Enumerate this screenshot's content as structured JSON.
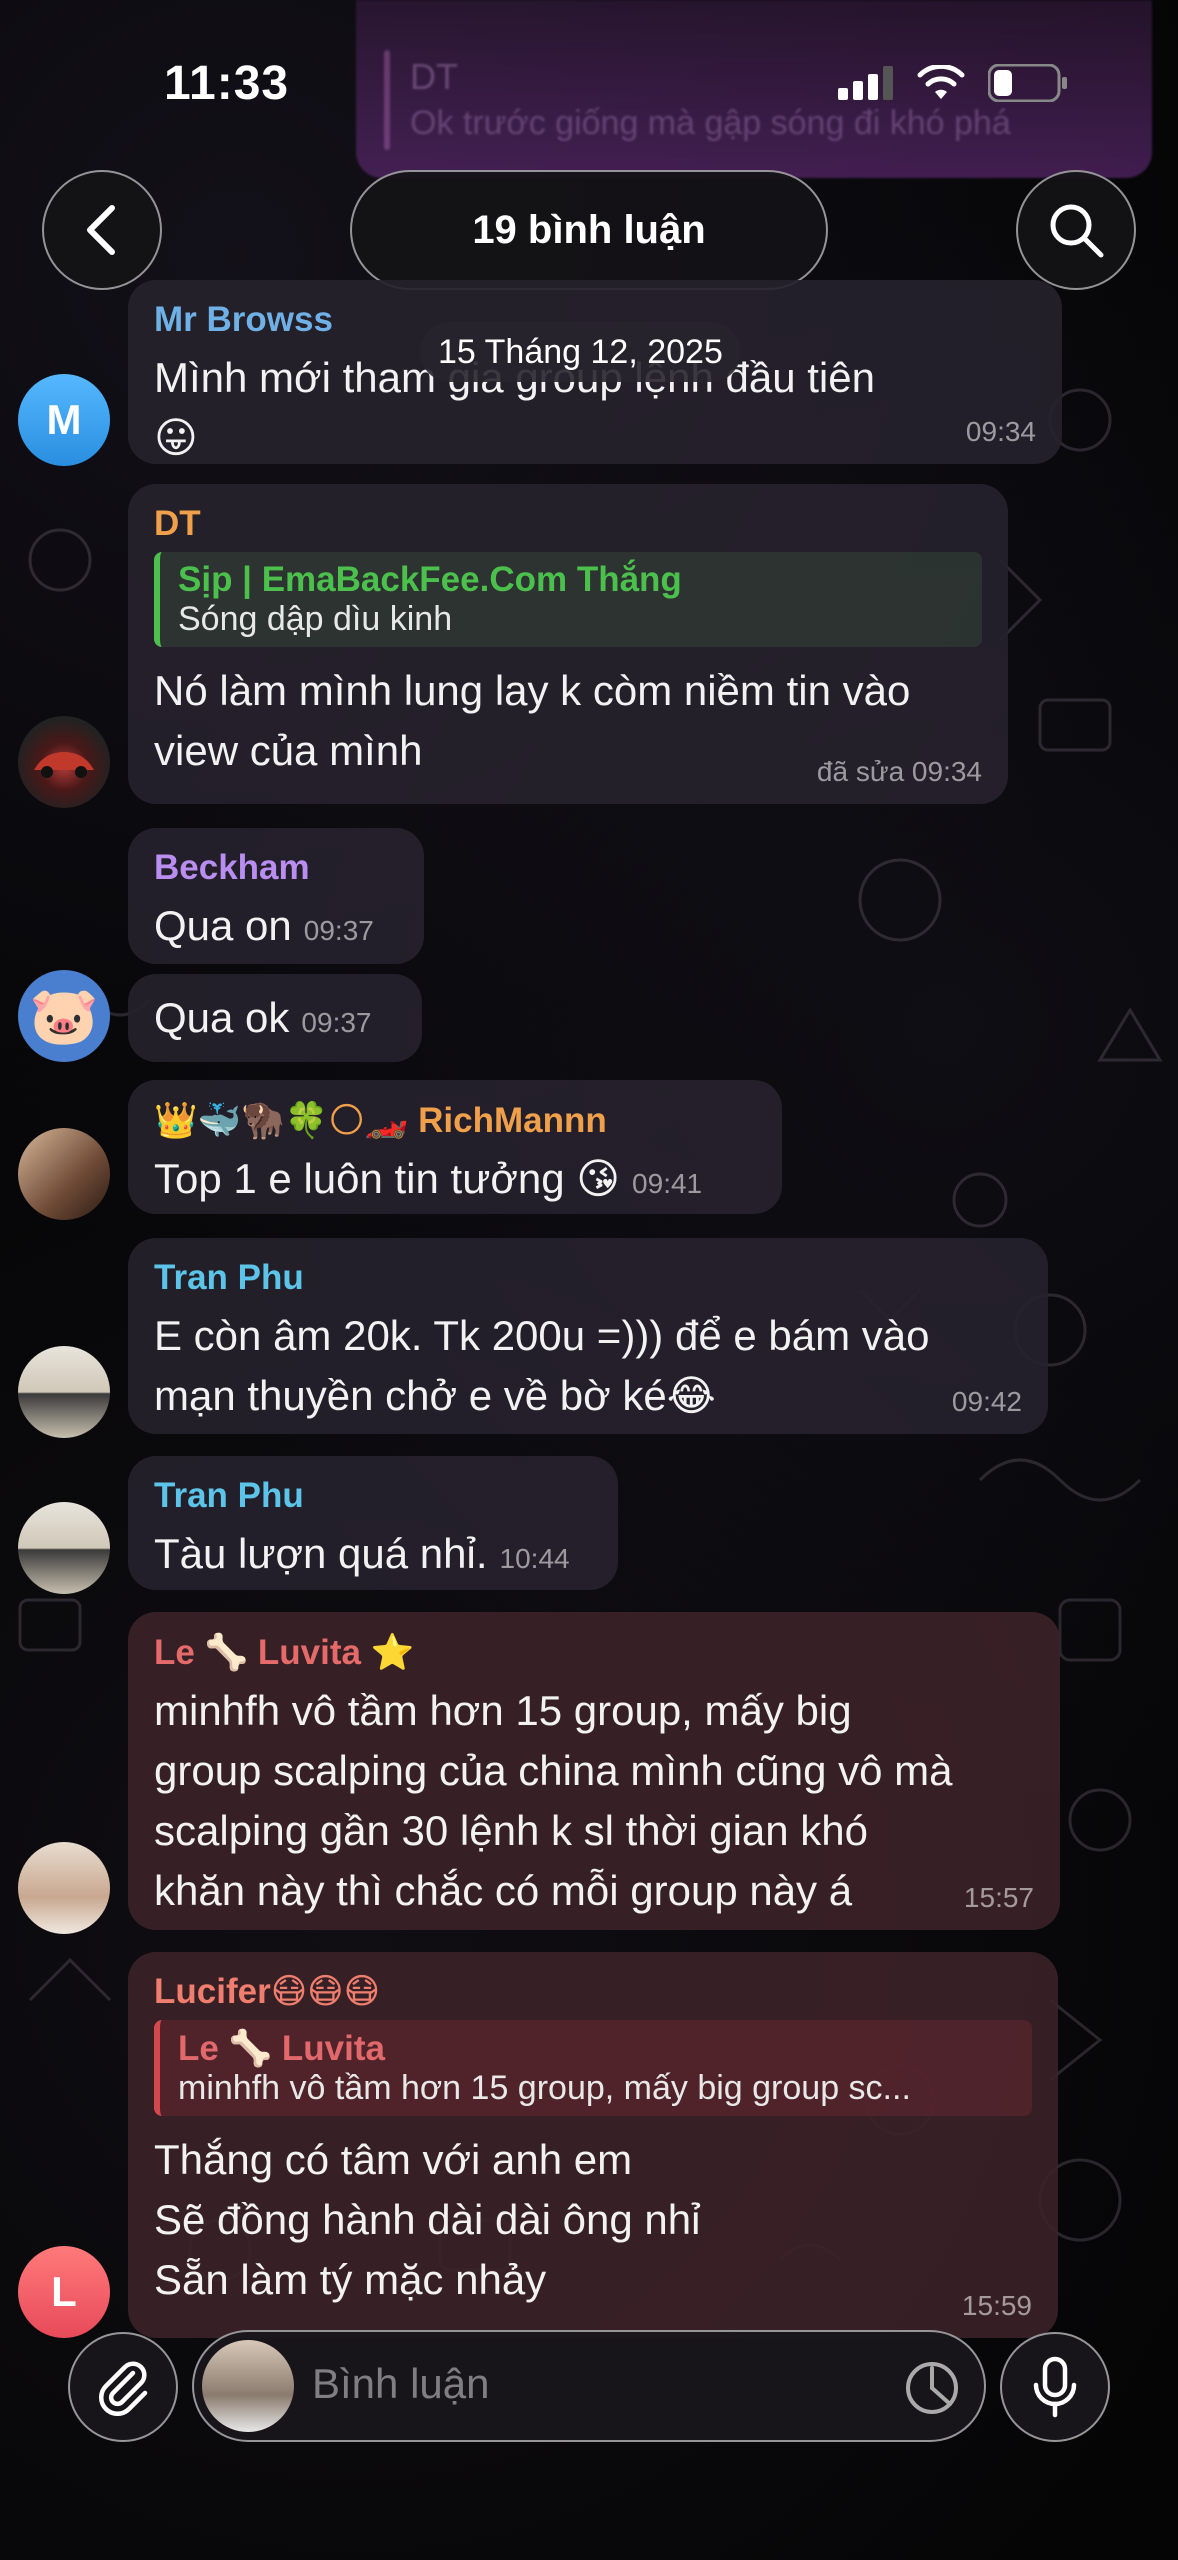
{
  "status_bar": {
    "time": "11:33"
  },
  "ghost_preview": {
    "name": "DT",
    "text": "Ok trước giống mà gập sóng đi khó phá"
  },
  "header": {
    "title": "19 bình luận"
  },
  "date_chip": "15 Tháng 12, 2025",
  "messages": [
    {
      "sender": "Mr Browss",
      "lines": [
        "Mình mới tham gia group lệnh đầu tiên",
        "😛"
      ],
      "time": "09:34",
      "avatar_letter": "M",
      "avatar_color": "#3aa3f0"
    },
    {
      "sender": "DT",
      "reply_name": "Sịp | EmaBackFee.Com Thắng",
      "reply_text": "Sóng dập dìu kinh",
      "lines": [
        "Nó làm mình lung lay k còm niềm tin vào",
        "view của mình"
      ],
      "time": "đã sửa 09:34"
    },
    {
      "sender": "Beckham",
      "lines": [
        "Qua on"
      ],
      "time": "09:37"
    },
    {
      "lines": [
        "Qua ok"
      ],
      "time": "09:37"
    },
    {
      "sender": "👑🐳🦬🍀🌕🏎️ RichMannn",
      "lines": [
        "Top 1 e luôn tin tưởng 😘"
      ],
      "time": "09:41"
    },
    {
      "sender": "Tran Phu",
      "lines": [
        "E còn âm 20k. Tk  200u =))) để e bám vào",
        "mạn thuyền chở e về bờ ké😂"
      ],
      "time": "09:42"
    },
    {
      "sender": "Tran Phu",
      "lines": [
        "Tàu lượn quá nhỉ."
      ],
      "time": "10:44"
    },
    {
      "sender": "Le 🦴 Luvita ⭐",
      "lines": [
        "minhfh vô tầm  hơn 15 group, mấy big",
        "group scalping của china mình cũng vô mà",
        "scalping gần 30 lệnh k  sl thời gian  khó",
        "khăn này thì chắc có mỗi group này á"
      ],
      "time": "15:57"
    },
    {
      "sender": "Lucifer😷😷😷",
      "reply_name": "Le 🦴 Luvita",
      "reply_text": "minhfh vô tầm hơn 15 group, mấy big group sc...",
      "lines": [
        "Thắng có tâm với anh em",
        "Sẽ đồng hành dài dài ông nhỉ",
        "Sẵn làm tý mặc nhảy"
      ],
      "time": "15:59",
      "avatar_letter": "L",
      "avatar_color": "#ef5b5b"
    }
  ],
  "input": {
    "placeholder": "Bình luận"
  },
  "colors": {
    "sender_blue": "#6fb0e6",
    "sender_orange": "#f0a04a",
    "sender_purple": "#b98ef0",
    "sender_cyan": "#5cc4e8",
    "sender_red": "#e56a6a",
    "sender_salmon": "#f07e6e",
    "reply_green": "#4cc04c",
    "reply_red": "#e2696b"
  }
}
